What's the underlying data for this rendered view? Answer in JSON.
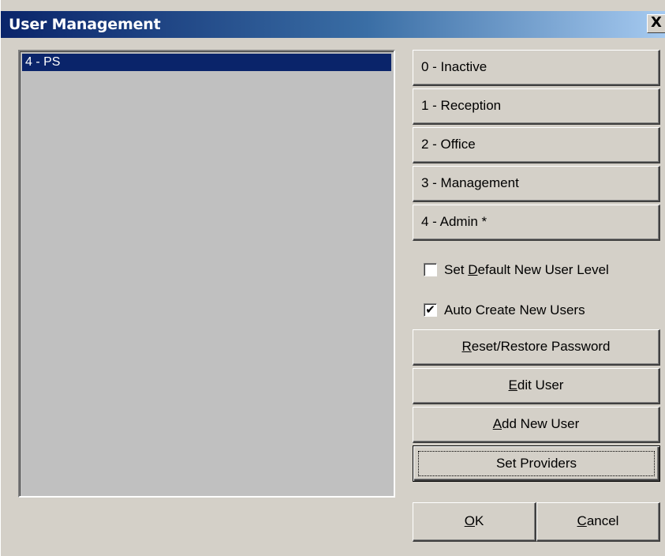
{
  "window": {
    "title": "User Management",
    "close_label": "X"
  },
  "user_list": {
    "items": [
      {
        "label": "4 - PS",
        "selected": true
      }
    ]
  },
  "level_buttons": [
    {
      "label": "0 - Inactive"
    },
    {
      "label": "1 - Reception"
    },
    {
      "label": "2 - Office"
    },
    {
      "label": "3 - Management"
    },
    {
      "label": "4 - Admin *"
    }
  ],
  "options": {
    "default_level": {
      "pre": "Set ",
      "key": "D",
      "post": "efault New User Level",
      "checked": false
    },
    "auto_create": {
      "label": "Auto Create New Users",
      "checked": true
    }
  },
  "actions": {
    "reset_password": {
      "key": "R",
      "rest": "eset/Restore Password"
    },
    "edit_user": {
      "key": "E",
      "rest": "dit User"
    },
    "add_new_user": {
      "key": "A",
      "rest": "dd New User"
    },
    "set_providers": {
      "label": "Set Providers"
    }
  },
  "dialog_buttons": {
    "ok": {
      "key": "O",
      "rest": "K"
    },
    "cancel": {
      "key": "C",
      "rest": "ancel"
    }
  },
  "colors": {
    "face": "#d4d0c8",
    "title_start": "#0a246a",
    "title_end": "#a6caf0",
    "selection": "#0a246a",
    "list_bg": "#c0c0c0"
  }
}
